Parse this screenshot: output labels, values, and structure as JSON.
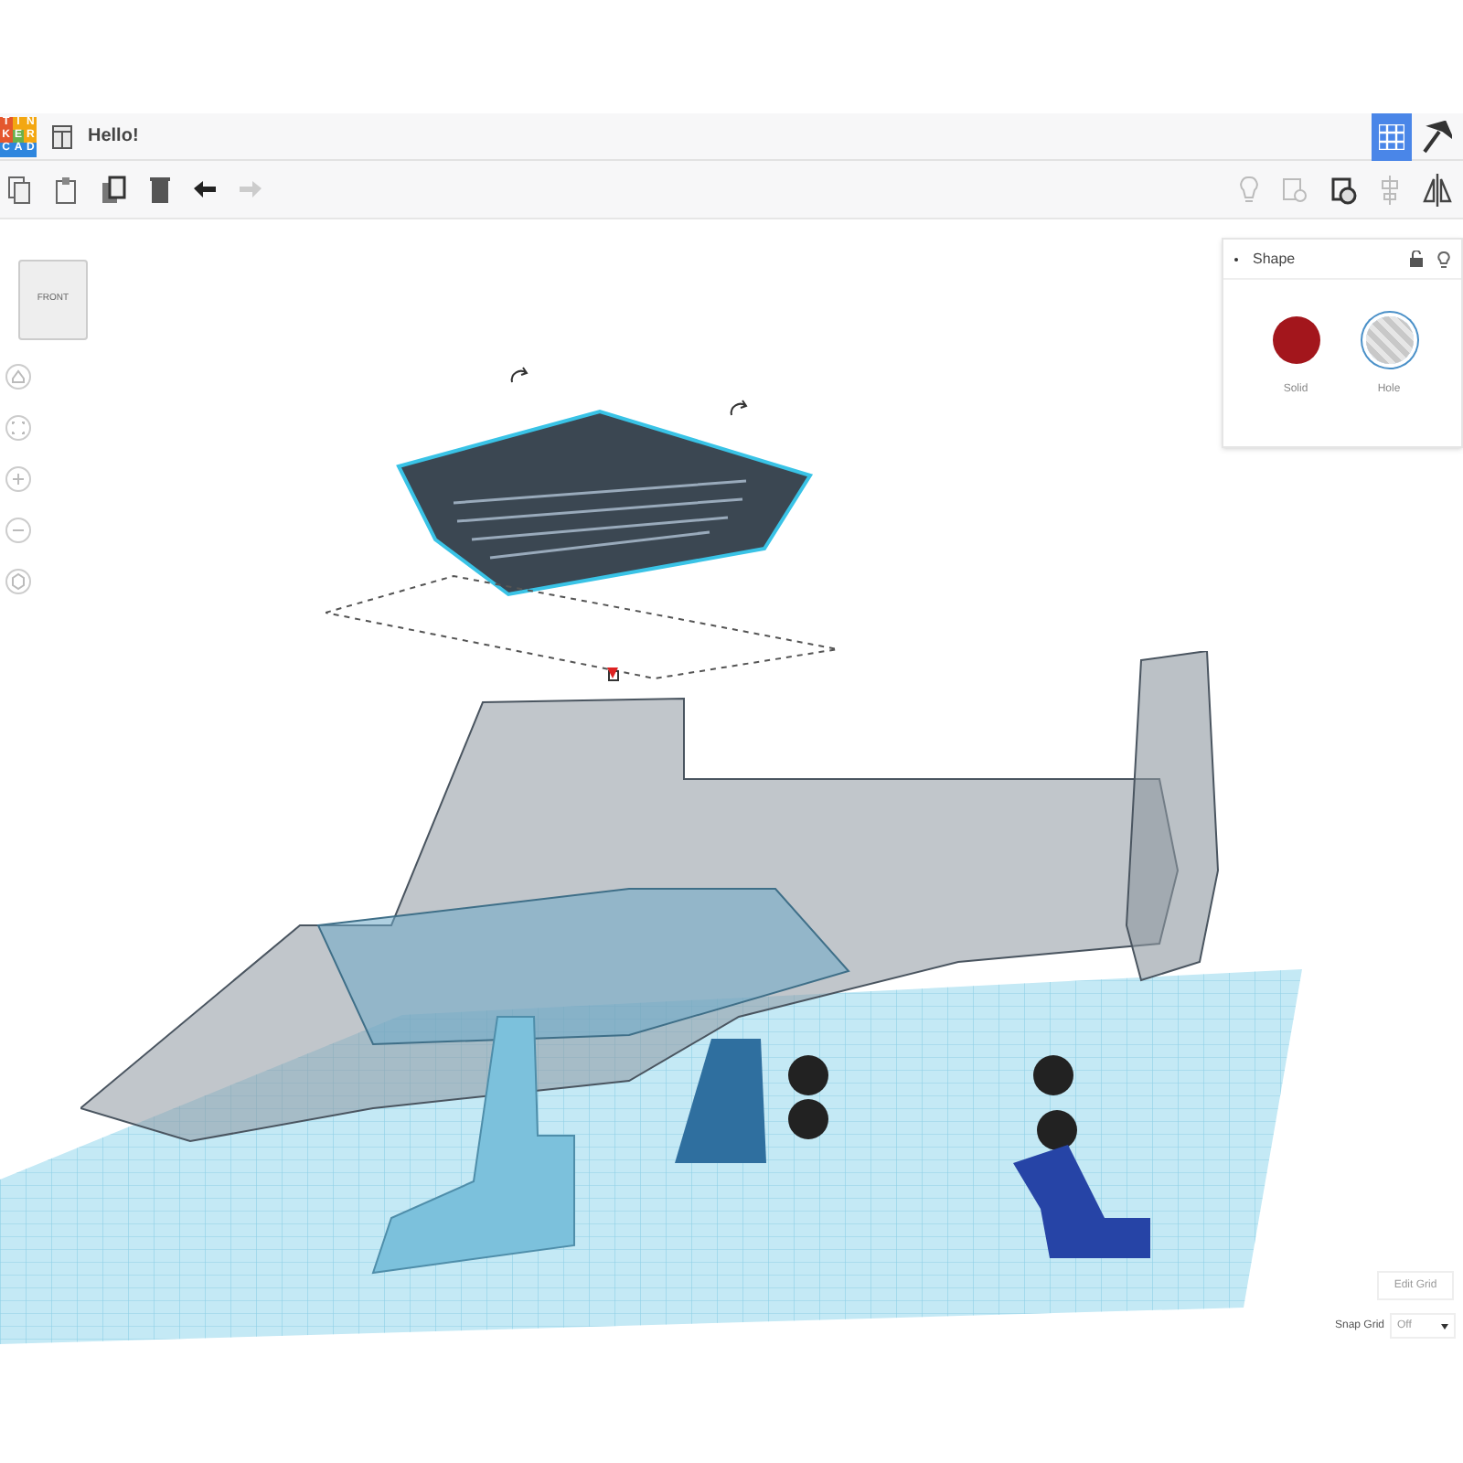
{
  "logo": {
    "letters": [
      "T",
      "I",
      "N",
      "K",
      "E",
      "R",
      "C",
      "A",
      "D"
    ]
  },
  "title": "Hello!",
  "view_cube": {
    "label": "FRONT"
  },
  "shape_panel": {
    "title": "Shape",
    "expanded": true,
    "options": [
      {
        "label": "Solid",
        "kind": "solid",
        "selected": false
      },
      {
        "label": "Hole",
        "kind": "hole",
        "selected": true
      }
    ]
  },
  "grid_view_on": true,
  "edit_grid": "Edit Grid",
  "snap_grid": {
    "label": "Snap Grid",
    "value": "Off"
  }
}
